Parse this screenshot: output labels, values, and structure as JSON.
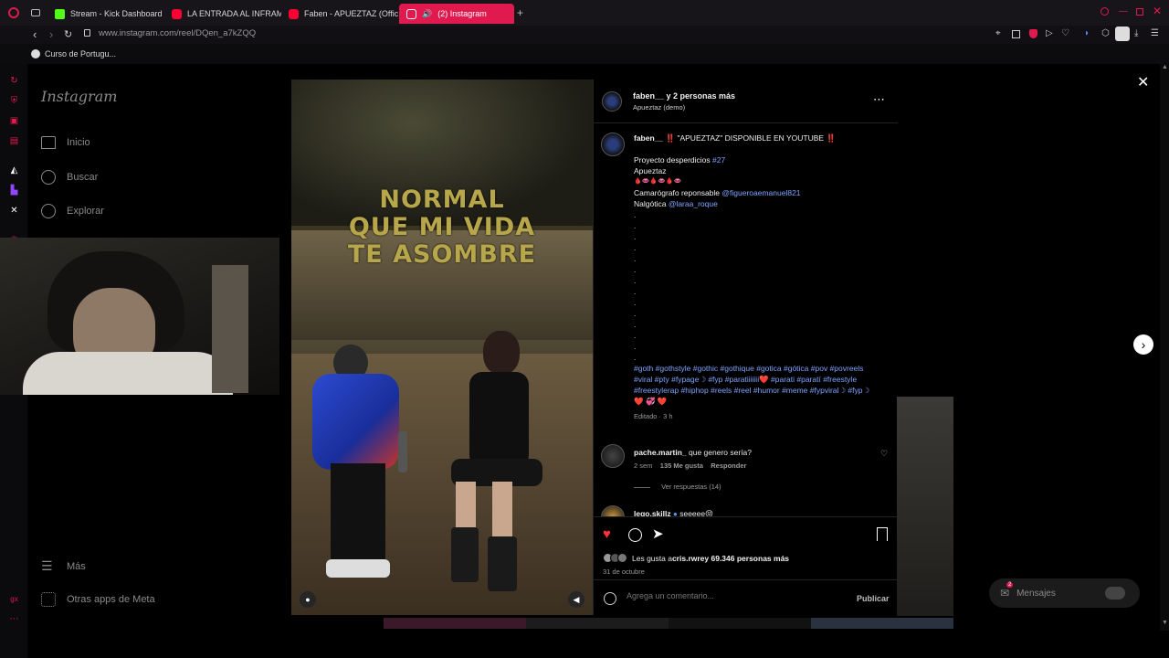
{
  "browser": {
    "tabs": [
      {
        "label": "Stream - Kick Dashboard",
        "color": "#53fc18"
      },
      {
        "label": "LA ENTRADA AL INFRAM",
        "color": "#ff0033"
      },
      {
        "label": "Faben - APUEZTAZ (Offic",
        "color": "#ff0033"
      },
      {
        "label": "(2) Instagram",
        "color": "#e4405f"
      }
    ],
    "url": "www.instagram.com/reel/DQen_a7kZQQ",
    "bookmark": "Curso de Portugu..."
  },
  "sidebar": {
    "logo": "Instagram",
    "items": [
      {
        "label": "Inicio",
        "icon": "home-icon"
      },
      {
        "label": "Buscar",
        "icon": "search-icon"
      },
      {
        "label": "Explorar",
        "icon": "compass-icon"
      }
    ],
    "bottom_items": [
      {
        "label": "Más",
        "icon": "menu-icon"
      },
      {
        "label": "Otras apps de Meta",
        "icon": "apps-icon"
      }
    ]
  },
  "video": {
    "overlay_text": "NORMAL QUE MI VIDA TE ASOMBRE"
  },
  "post": {
    "header_user": "faben__ y 2 personas más",
    "header_audio": "Apueztaz (demo)",
    "caption_user": "faben__",
    "caption_title": "‼️ \"APUEZTAZ\" DISPONIBLE EN YOUTUBE ‼️",
    "caption_line1_text": "Proyecto desperdicios ",
    "caption_line1_tag": "#27",
    "caption_line2": "Apueztaz",
    "caption_line3": "🩸👄🩸👄🩸👄",
    "caption_line4_text": "Camarógrafo reponsable ",
    "caption_line4_mention": "@figueroaemanuel821",
    "caption_line5_text": "Nalgótica ",
    "caption_line5_mention": "@laraa_roque",
    "hashtags": "#goth #gothstyle #gothic #gothique #gotica #gótica #pov #povreels #viral #pty #fypage☽ #fyp #paratiiiiiii❤️ #parati #paratí #freestyle #freestylerap #hiphop #reels #reel #humor #meme #fypviral☽ #fyp☽ ❤️ 💞 ❤️",
    "edited": "Editado · 3 h"
  },
  "comments": [
    {
      "user": "pache.martin_",
      "text": "que genero sería?",
      "age": "2 sem",
      "likes": "135 Me gusta",
      "reply": "Responder",
      "view_replies": "Ver respuestas (14)"
    },
    {
      "user": "lego.skillz",
      "text": "seeeee😝"
    }
  ],
  "actions": {
    "likes_text_prefix": "Les gusta a ",
    "likes_user": "cris.rwre",
    "likes_text_suffix": " y 69.346 personas más",
    "date": "31 de octubre",
    "comment_placeholder": "Agrega un comentario...",
    "publish": "Publicar"
  },
  "messages": {
    "label": "Mensajes",
    "badge": "2"
  },
  "colors": {
    "accent": "#e01a4f",
    "like": "#ff3040",
    "link": "#7fa3ff"
  }
}
